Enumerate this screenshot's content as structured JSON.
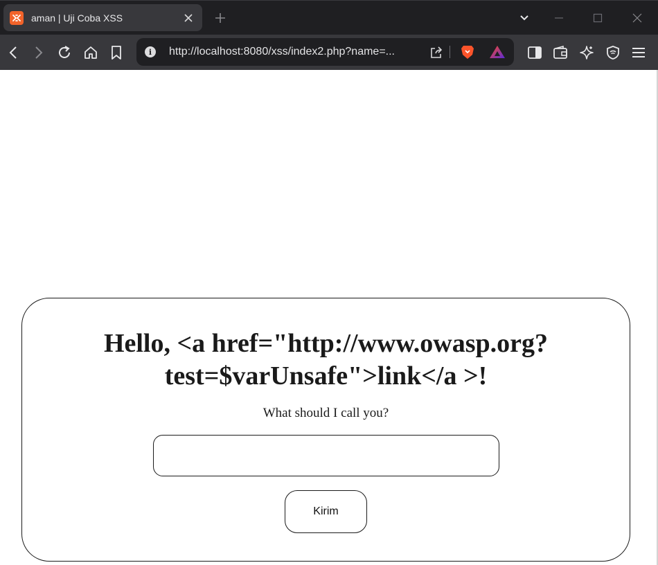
{
  "browser": {
    "tab": {
      "title": "aman | Uji Coba XSS"
    },
    "address_bar": {
      "url": "http://localhost:8080/xss/index2.php?name=..."
    }
  },
  "page": {
    "greeting": "Hello, <a href=\"http://www.owasp.org?test=$varUnsafe\">link</a >!",
    "prompt": "What should I call you?",
    "name_input_value": "",
    "submit_label": "Kirim"
  },
  "colors": {
    "chrome_dark": "#1f1f22",
    "chrome_toolbar": "#38383c",
    "favicon": "#f2632a",
    "brave_orange": "#fb542b"
  }
}
